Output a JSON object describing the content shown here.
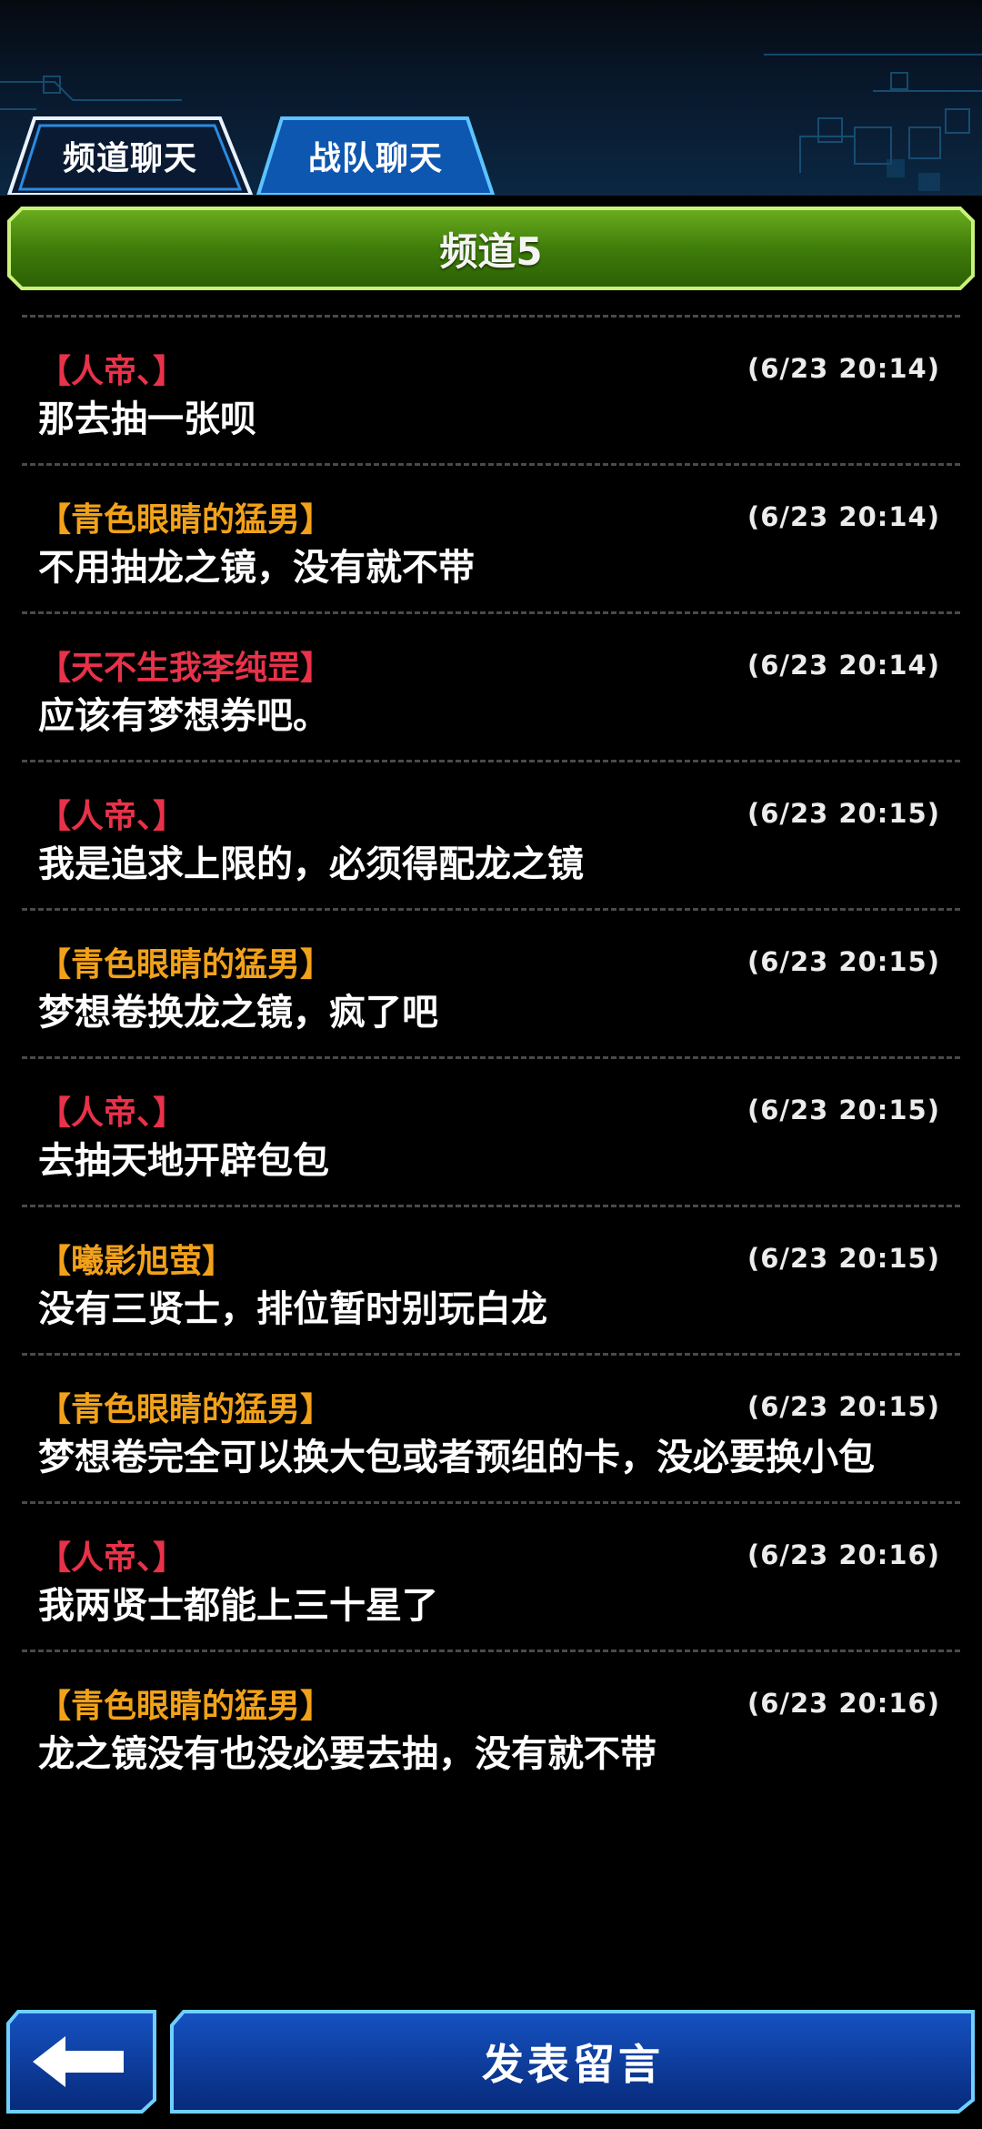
{
  "tabs": [
    {
      "label": "频道聊天",
      "active": true
    },
    {
      "label": "战队聊天",
      "active": false
    }
  ],
  "channel": {
    "title": "频道5"
  },
  "colors": {
    "name_red": "#e8324a",
    "name_orange": "#f2a21a",
    "header_green": "#4d8e0c",
    "button_blue": "#0a3a9a"
  },
  "messages": [
    {
      "user": "【人帝、】",
      "color": "red",
      "time": "(6/23 20:14)",
      "text": "那去抽一张呗"
    },
    {
      "user": "【青色眼睛的猛男】",
      "color": "orange",
      "time": "(6/23 20:14)",
      "text": "不用抽龙之镜，没有就不带"
    },
    {
      "user": "【天不生我李纯罡】",
      "color": "red",
      "time": "(6/23 20:14)",
      "text": "应该有梦想券吧。"
    },
    {
      "user": "【人帝、】",
      "color": "red",
      "time": "(6/23 20:15)",
      "text": "我是追求上限的，必须得配龙之镜"
    },
    {
      "user": "【青色眼睛的猛男】",
      "color": "orange",
      "time": "(6/23 20:15)",
      "text": "梦想卷换龙之镜，疯了吧"
    },
    {
      "user": "【人帝、】",
      "color": "red",
      "time": "(6/23 20:15)",
      "text": "去抽天地开辟包包"
    },
    {
      "user": "【曦影旭萤】",
      "color": "orange",
      "time": "(6/23 20:15)",
      "text": "没有三贤士，排位暂时别玩白龙"
    },
    {
      "user": "【青色眼睛的猛男】",
      "color": "orange",
      "time": "(6/23 20:15)",
      "text": "梦想卷完全可以换大包或者预组的卡，没必要换小包"
    },
    {
      "user": "【人帝、】",
      "color": "red",
      "time": "(6/23 20:16)",
      "text": "我两贤士都能上三十星了"
    },
    {
      "user": "【青色眼睛的猛男】",
      "color": "orange",
      "time": "(6/23 20:16)",
      "text": "龙之镜没有也没必要去抽，没有就不带"
    }
  ],
  "bottom": {
    "post_label": "发表留言",
    "back_icon": "arrow-left-icon"
  }
}
